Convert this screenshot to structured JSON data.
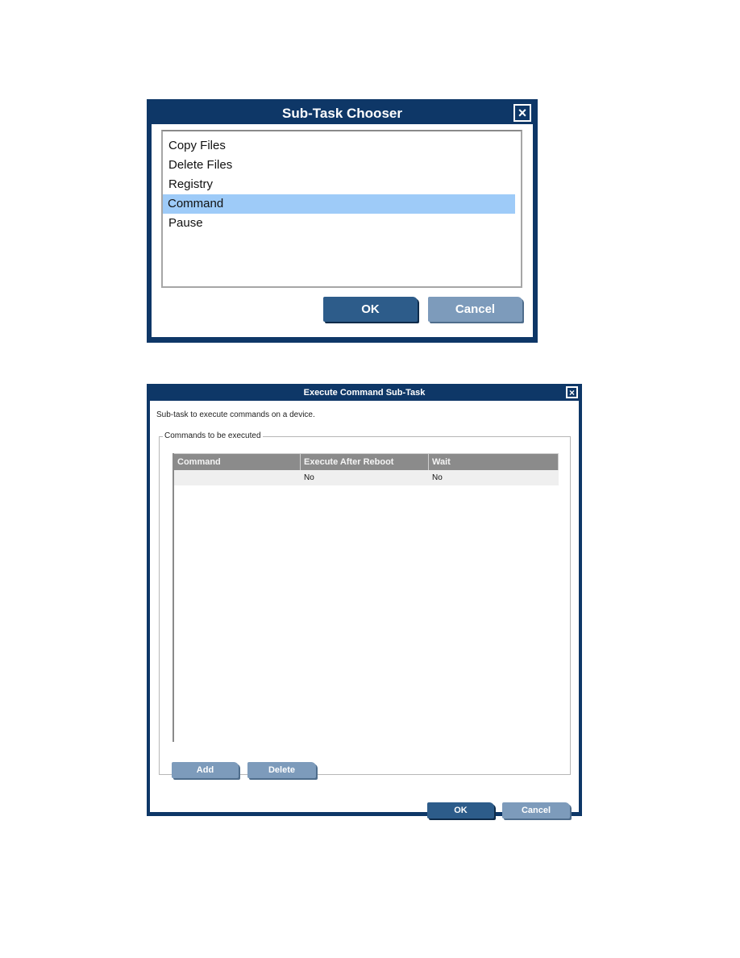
{
  "chooser": {
    "title": "Sub-Task Chooser",
    "close_icon": "×",
    "items": [
      {
        "label": "Copy Files",
        "selected": false
      },
      {
        "label": "Delete Files",
        "selected": false
      },
      {
        "label": "Registry",
        "selected": false
      },
      {
        "label": "Command",
        "selected": true
      },
      {
        "label": "Pause",
        "selected": false
      }
    ],
    "ok_label": "OK",
    "cancel_label": "Cancel"
  },
  "execute": {
    "title": "Execute Command Sub-Task",
    "close_icon": "×",
    "description": "Sub-task to execute commands on a device.",
    "group_label": "Commands to be executed",
    "columns": [
      "Command",
      "Execute After Reboot",
      "Wait"
    ],
    "rows": [
      {
        "command": "",
        "execute_after_reboot": "No",
        "wait": "No"
      }
    ],
    "add_label": "Add",
    "delete_label": "Delete",
    "ok_label": "OK",
    "cancel_label": "Cancel"
  },
  "colors": {
    "dialog_frame": "#0e3767",
    "selection": "#9ecbf8",
    "button_primary": "#2d5c8a",
    "button_secondary": "#7d9bbb",
    "table_header": "#8b8b8b"
  }
}
